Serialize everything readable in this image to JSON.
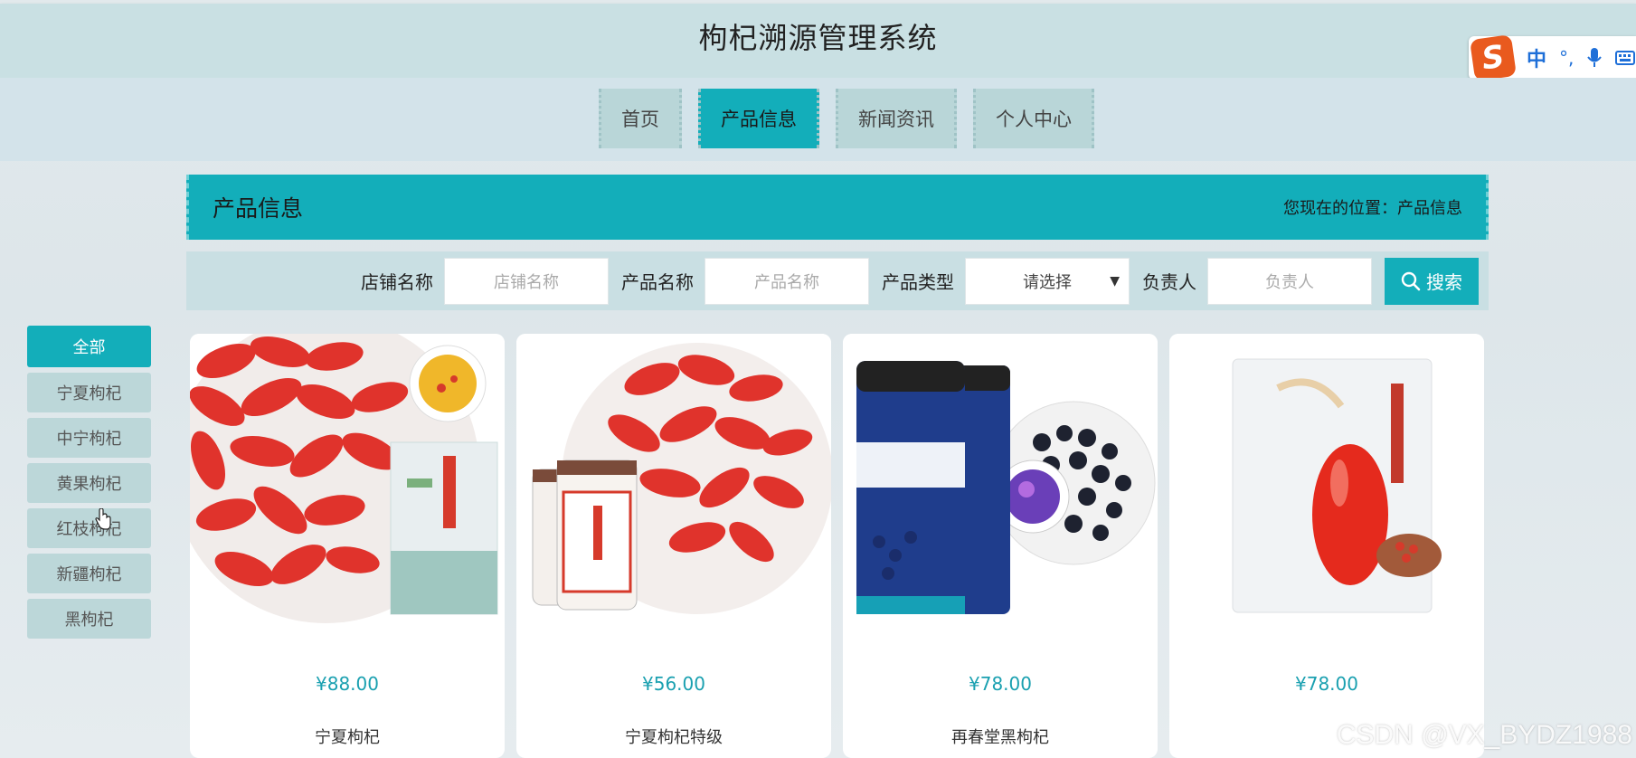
{
  "header": {
    "title": "枸杞溯源管理系统"
  },
  "nav": {
    "items": [
      {
        "label": "首页"
      },
      {
        "label": "产品信息"
      },
      {
        "label": "新闻资讯"
      },
      {
        "label": "个人中心"
      }
    ],
    "active_index": 1
  },
  "ime": {
    "logo": "S",
    "mode": "中",
    "punct": "°,"
  },
  "section": {
    "title": "产品信息",
    "location": "您现在的位置：产品信息"
  },
  "search": {
    "shop_label": "店铺名称",
    "shop_placeholder": "店铺名称",
    "product_label": "产品名称",
    "product_placeholder": "产品名称",
    "type_label": "产品类型",
    "type_selected": "请选择",
    "owner_label": "负责人",
    "owner_placeholder": "负责人",
    "button_label": "搜索"
  },
  "categories": [
    "全部",
    "宁夏枸杞",
    "中宁枸杞",
    "黄果枸杞",
    "红枝枸杞",
    "新疆枸杞",
    "黑枸杞"
  ],
  "products": [
    {
      "price": "¥88.00",
      "name": "宁夏枸杞"
    },
    {
      "price": "¥56.00",
      "name": "宁夏枸杞特级"
    },
    {
      "price": "¥78.00",
      "name": "再春堂黑枸杞"
    },
    {
      "price": "¥78.00",
      "name": ""
    }
  ],
  "watermark": "CSDN @VX_BYDZ1988",
  "colors": {
    "accent": "#13aeba",
    "nav_bg": "#b9d6d8",
    "header_bg": "#c9e0e3"
  }
}
